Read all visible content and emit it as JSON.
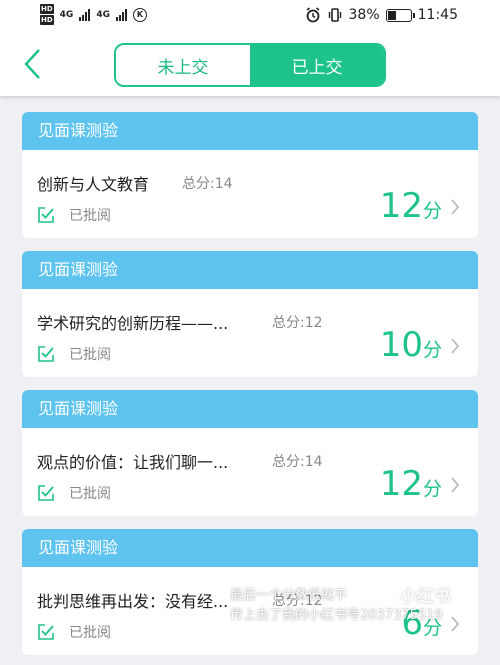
{
  "status_bar": {
    "hd_top": "HD",
    "hd_bottom": "HD",
    "net1": "4G",
    "net2": "4G",
    "carrier_icon": "K",
    "battery": "38%",
    "time": "11:45",
    "icons": [
      "alarm-icon",
      "vibrate-icon",
      "battery-icon"
    ]
  },
  "header": {
    "tabs": [
      {
        "label": "未上交",
        "active": false
      },
      {
        "label": "已上交",
        "active": true
      }
    ],
    "accent_color": "#1ec28b",
    "back_icon": "chevron-left-icon"
  },
  "cards": [
    {
      "category": "见面课测验",
      "title": "创新与人文教育",
      "total": "总分:14",
      "status": "已批阅",
      "score": "12",
      "unit": "分"
    },
    {
      "category": "见面课测验",
      "title": "学术研究的创新历程——...",
      "total": "总分:12",
      "status": "已批阅",
      "score": "10",
      "unit": "分"
    },
    {
      "category": "见面课测验",
      "title": "观点的价值：让我们聊一...",
      "total": "总分:14",
      "status": "已批阅",
      "score": "12",
      "unit": "分"
    },
    {
      "category": "见面课测验",
      "title": "批判思维再出发：没有经...",
      "total": "总分:12",
      "status": "已批阅",
      "score": "6",
      "unit": "分"
    }
  ],
  "colors": {
    "card_header": "#5ec3ef",
    "score": "#1ec28b",
    "background": "#eef0f3"
  },
  "overlay": {
    "line1": "最后一个分数低就不",
    "line2": "传上去了我的小红书号2037375519",
    "watermark": "小红书"
  }
}
